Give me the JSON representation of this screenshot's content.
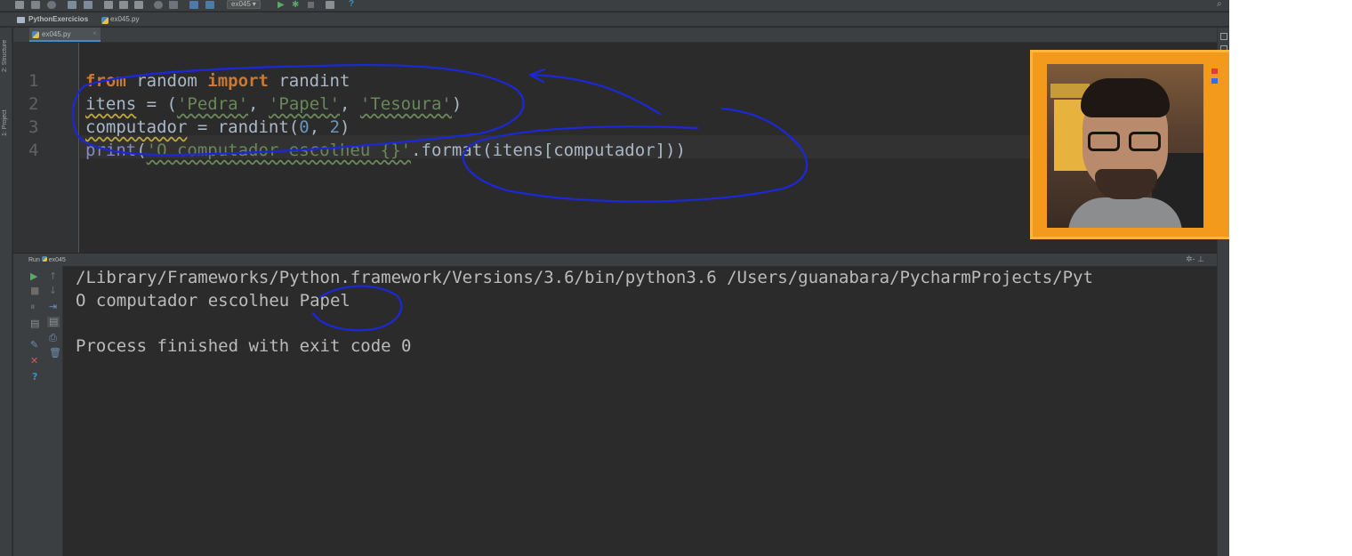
{
  "toolbar": {
    "run_config": "ex045",
    "run_config_chevron": "▾",
    "run_icon": "run-icon",
    "debug_icon": "debug-icon",
    "help_label": "?"
  },
  "breadcrumb": {
    "project": "PythonExercicios",
    "file": "ex045.py"
  },
  "left_strip": {
    "structure_label": "2: Structure",
    "project_label": "1: Project"
  },
  "editor": {
    "tab_label": "ex045.py",
    "tab_close": "×",
    "line_numbers": [
      "1",
      "2",
      "3",
      "4"
    ],
    "code": {
      "l1_from": "from",
      "l1_mod": " random ",
      "l1_import": "import",
      "l1_name": " randint",
      "l2_var": "itens",
      "l2_eq": " = (",
      "l2_s1": "'Pedra'",
      "l2_c1": ", ",
      "l2_s2": "'Papel'",
      "l2_c2": ", ",
      "l2_s3": "'Tesoura'",
      "l2_close": ")",
      "l3_var": "computador",
      "l3_eq": " = randint(",
      "l3_n0": "0",
      "l3_comma": ", ",
      "l3_n2": "2",
      "l3_close": ")",
      "l4_print": "print",
      "l4_open": "(",
      "l4_str": "'O computador escolheu {}'",
      "l4_fmt": ".format(itens[computador]))"
    }
  },
  "run_panel": {
    "title": "Run",
    "config": "ex045",
    "tools": "✲- ⊥",
    "console_lines": [
      "/Library/Frameworks/Python.framework/Versions/3.6/bin/python3.6 /Users/guanabara/PycharmProjects/Pyt",
      "O computador escolheu Papel",
      "",
      "Process finished with exit code 0"
    ]
  },
  "colors": {
    "keyword": "#cc7832",
    "string": "#6a8759",
    "number": "#6897bb",
    "annotation_ink": "#1c28d8",
    "webcam_frame": "#f39a1c"
  }
}
